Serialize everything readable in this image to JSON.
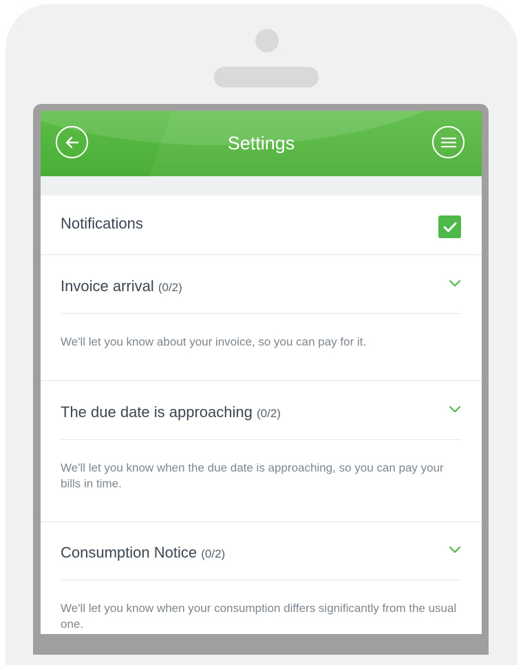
{
  "header": {
    "title": "Settings",
    "back_icon": "arrow-left-icon",
    "menu_icon": "menu-icon"
  },
  "notifications": {
    "label": "Notifications",
    "checked": true
  },
  "items": [
    {
      "title": "Invoice arrival",
      "count": "(0/2)",
      "description": "We'll let you know about your invoice, so you can pay for it."
    },
    {
      "title": "The due date is approaching",
      "count": "(0/2)",
      "description": "We'll let you know when the due date is approaching, so you can pay your bills in time."
    },
    {
      "title": "Consumption Notice",
      "count": "(0/2)",
      "description": "We'll let you know when your consumption differs significantly from the usual one."
    }
  ],
  "colors": {
    "brand_green": "#4fb84a",
    "header_green": "#5cbd46",
    "text_dark": "#3c4650",
    "text_muted": "#7d868e"
  }
}
